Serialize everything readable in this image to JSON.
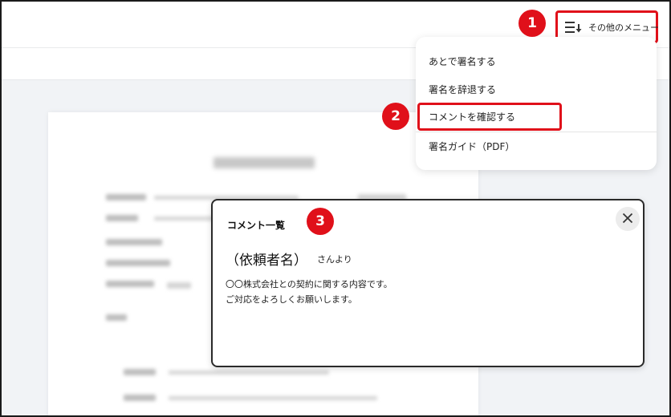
{
  "header": {
    "menu_button_label": "その他のメニュー"
  },
  "dropdown": {
    "items": [
      {
        "label": "あとで署名する"
      },
      {
        "label": "署名を辞退する"
      },
      {
        "label": "コメントを確認する"
      },
      {
        "label": "署名ガイド（PDF）"
      }
    ]
  },
  "badges": {
    "one": "1",
    "two": "2",
    "three": "3"
  },
  "comment_dialog": {
    "title": "コメント一覧",
    "requester": "（依頼者名）",
    "requester_suffix": "さんより",
    "message_lines": [
      "〇〇株式会社との契約に関する内容です。",
      "ご対応をよろしくお願いします。"
    ]
  },
  "colors": {
    "accent_red": "#e0101a",
    "viewer_bg": "#f1f3f6"
  },
  "icons": {
    "menu": "list-sort-icon",
    "close": "close-icon"
  }
}
